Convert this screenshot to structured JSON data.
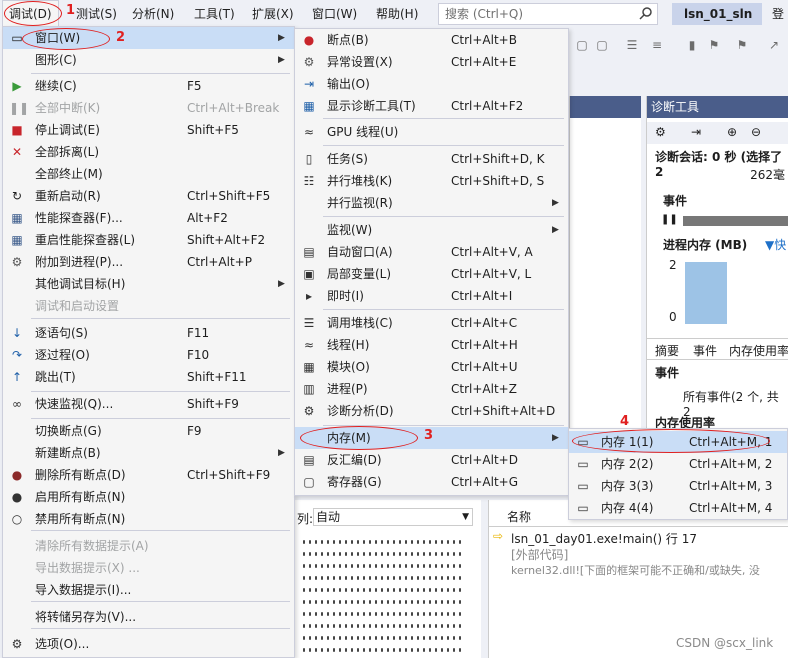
{
  "menubar": {
    "items": [
      "调试(D)",
      "测试(S)",
      "分析(N)",
      "工具(T)",
      "扩展(X)",
      "窗口(W)",
      "帮助(H)"
    ],
    "search_placeholder": "搜索 (Ctrl+Q)",
    "solution": "lsn_01_sln",
    "login": "登"
  },
  "debug_menu": {
    "items": [
      {
        "label": "窗口(W)",
        "shortcut": "",
        "icon": "window-icon",
        "arrow": true,
        "highlight": true
      },
      {
        "label": "图形(C)",
        "shortcut": "",
        "icon": "",
        "arrow": true
      },
      {
        "label": "继续(C)",
        "shortcut": "F5",
        "icon": "play-icon"
      },
      {
        "label": "全部中断(K)",
        "shortcut": "Ctrl+Alt+Break",
        "icon": "pause-icon",
        "disabled": true
      },
      {
        "label": "停止调试(E)",
        "shortcut": "Shift+F5",
        "icon": "stop-icon"
      },
      {
        "label": "全部拆离(L)",
        "shortcut": "",
        "icon": "close-icon"
      },
      {
        "label": "全部终止(M)",
        "shortcut": "",
        "icon": ""
      },
      {
        "label": "重新启动(R)",
        "shortcut": "Ctrl+Shift+F5",
        "icon": "restart-icon"
      },
      {
        "label": "性能探查器(F)...",
        "shortcut": "Alt+F2",
        "icon": "profiler-icon"
      },
      {
        "label": "重启性能探查器(L)",
        "shortcut": "Shift+Alt+F2",
        "icon": "profiler-icon"
      },
      {
        "label": "附加到进程(P)...",
        "shortcut": "Ctrl+Alt+P",
        "icon": "attach-icon"
      },
      {
        "label": "其他调试目标(H)",
        "shortcut": "",
        "icon": "",
        "arrow": true
      },
      {
        "label": "调试和启动设置",
        "shortcut": "",
        "icon": "",
        "disabled": true
      },
      {
        "label": "逐语句(S)",
        "shortcut": "F11",
        "icon": "step-into-icon"
      },
      {
        "label": "逐过程(O)",
        "shortcut": "F10",
        "icon": "step-over-icon"
      },
      {
        "label": "跳出(T)",
        "shortcut": "Shift+F11",
        "icon": "step-out-icon"
      },
      {
        "label": "快速监视(Q)...",
        "shortcut": "Shift+F9",
        "icon": "quickwatch-icon"
      },
      {
        "label": "切换断点(G)",
        "shortcut": "F9",
        "icon": ""
      },
      {
        "label": "新建断点(B)",
        "shortcut": "",
        "icon": "",
        "arrow": true
      },
      {
        "label": "删除所有断点(D)",
        "shortcut": "Ctrl+Shift+F9",
        "icon": "delete-breakpoints-icon"
      },
      {
        "label": "启用所有断点(N)",
        "shortcut": "",
        "icon": "enable-breakpoints-icon"
      },
      {
        "label": "禁用所有断点(N)",
        "shortcut": "",
        "icon": "disable-breakpoints-icon"
      },
      {
        "label": "清除所有数据提示(A)",
        "shortcut": "",
        "icon": "",
        "disabled": true
      },
      {
        "label": "导出数据提示(X) ...",
        "shortcut": "",
        "icon": "",
        "disabled": true
      },
      {
        "label": "导入数据提示(I)...",
        "shortcut": "",
        "icon": ""
      },
      {
        "label": "将转储另存为(V)...",
        "shortcut": "",
        "icon": ""
      },
      {
        "label": "选项(O)...",
        "shortcut": "",
        "icon": "gear-icon"
      }
    ]
  },
  "window_menu": {
    "items": [
      {
        "label": "断点(B)",
        "shortcut": "Ctrl+Alt+B",
        "icon": "breakpoint-icon"
      },
      {
        "label": "异常设置(X)",
        "shortcut": "Ctrl+Alt+E",
        "icon": "exception-icon"
      },
      {
        "label": "输出(O)",
        "shortcut": "",
        "icon": "output-icon"
      },
      {
        "label": "显示诊断工具(T)",
        "shortcut": "Ctrl+Alt+F2",
        "icon": "diagnostics-icon"
      },
      {
        "label": "GPU 线程(U)",
        "shortcut": "",
        "icon": "gpu-icon"
      },
      {
        "label": "任务(S)",
        "shortcut": "Ctrl+Shift+D, K",
        "icon": "tasks-icon"
      },
      {
        "label": "并行堆栈(K)",
        "shortcut": "Ctrl+Shift+D, S",
        "icon": "parallel-stacks-icon"
      },
      {
        "label": "并行监视(R)",
        "shortcut": "",
        "icon": "",
        "arrow": true
      },
      {
        "label": "监视(W)",
        "shortcut": "",
        "icon": "",
        "arrow": true
      },
      {
        "label": "自动窗口(A)",
        "shortcut": "Ctrl+Alt+V, A",
        "icon": "autos-icon"
      },
      {
        "label": "局部变量(L)",
        "shortcut": "Ctrl+Alt+V, L",
        "icon": "locals-icon"
      },
      {
        "label": "即时(I)",
        "shortcut": "Ctrl+Alt+I",
        "icon": "immediate-icon"
      },
      {
        "label": "调用堆栈(C)",
        "shortcut": "Ctrl+Alt+C",
        "icon": "callstack-icon"
      },
      {
        "label": "线程(H)",
        "shortcut": "Ctrl+Alt+H",
        "icon": "threads-icon"
      },
      {
        "label": "模块(O)",
        "shortcut": "Ctrl+Alt+U",
        "icon": "modules-icon"
      },
      {
        "label": "进程(P)",
        "shortcut": "Ctrl+Alt+Z",
        "icon": "processes-icon"
      },
      {
        "label": "诊断分析(D)",
        "shortcut": "Ctrl+Shift+Alt+D",
        "icon": "diagnostic-analysis-icon"
      },
      {
        "label": "内存(M)",
        "shortcut": "",
        "icon": "",
        "arrow": true,
        "highlight": true
      },
      {
        "label": "反汇编(D)",
        "shortcut": "Ctrl+Alt+D",
        "icon": "disassembly-icon"
      },
      {
        "label": "寄存器(G)",
        "shortcut": "Ctrl+Alt+G",
        "icon": "registers-icon"
      }
    ]
  },
  "memory_menu": {
    "items": [
      {
        "label": "内存 1(1)",
        "shortcut": "Ctrl+Alt+M, 1",
        "highlight": true
      },
      {
        "label": "内存 2(2)",
        "shortcut": "Ctrl+Alt+M, 2"
      },
      {
        "label": "内存 3(3)",
        "shortcut": "Ctrl+Alt+M, 3"
      },
      {
        "label": "内存 4(4)",
        "shortcut": "Ctrl+Alt+M, 4"
      }
    ]
  },
  "annotations": [
    "1",
    "2",
    "3",
    "4"
  ],
  "diagnostics": {
    "title": "诊断工具",
    "session": "诊断会话: 0 秒 (选择了 2",
    "session_value": "262毫",
    "events_label": "事件",
    "process_memory": "进程内存 (MB)",
    "fast": "快",
    "y_top": "2",
    "y_bottom": "0",
    "tabs": [
      "摘要",
      "事件",
      "内存使用率"
    ],
    "events_section": "事件",
    "all_events": "所有事件(2 个, 共 2",
    "memory_usage": "内存使用率"
  },
  "bottom": {
    "columns_label": "列:",
    "columns_value": "自动",
    "name_header": "名称",
    "stack_rows": [
      "lsn_01_day01.exe!main() 行 17",
      "[外部代码]",
      "kernel32.dll![下面的框架可能不正确和/或缺失, 没"
    ]
  },
  "watermark": "CSDN @scx_link"
}
